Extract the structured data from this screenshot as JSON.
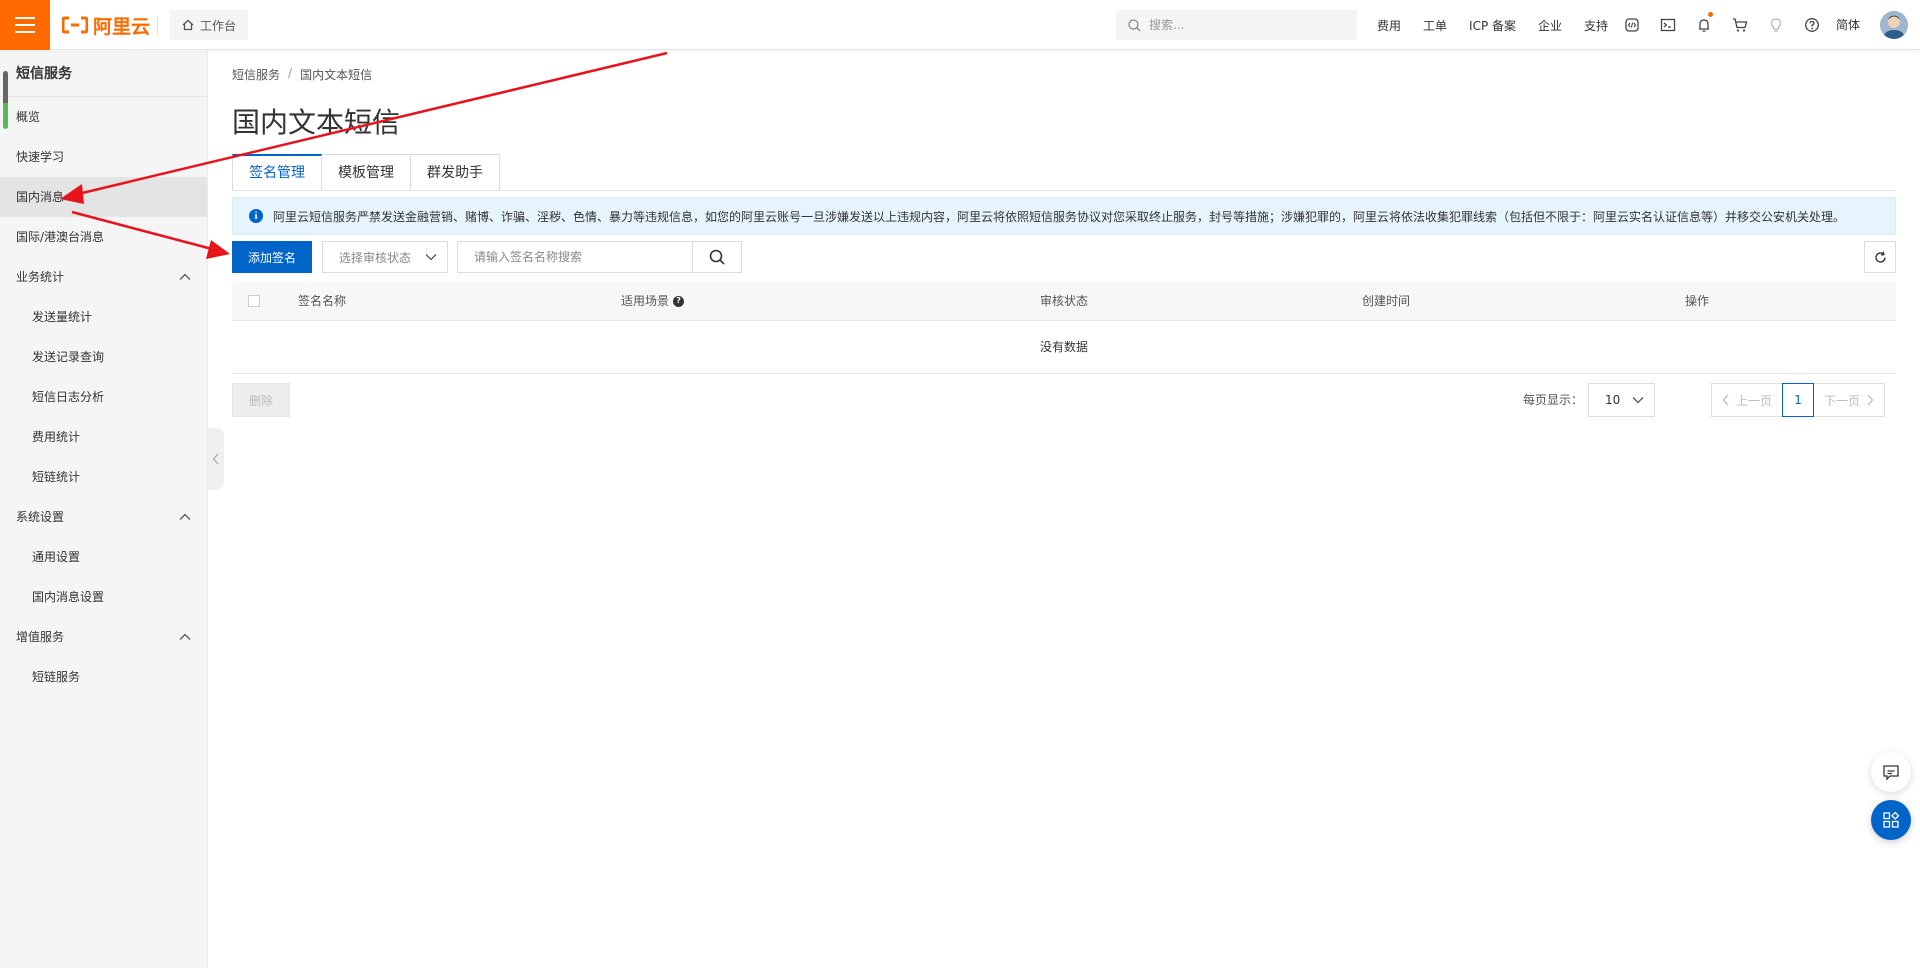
{
  "topbar": {
    "logo_text": "阿里云",
    "workbench_label": "工作台",
    "search_placeholder": "搜索...",
    "links": [
      "费用",
      "工单",
      "ICP 备案",
      "企业",
      "支持"
    ],
    "lang": "简体",
    "icons": [
      "code-icon",
      "terminal-icon",
      "bell-icon",
      "cart-icon",
      "bulb-icon",
      "help-icon"
    ]
  },
  "sidebar": {
    "title": "短信服务",
    "items": [
      {
        "label": "概览"
      },
      {
        "label": "快速学习"
      },
      {
        "label": "国内消息"
      },
      {
        "label": "国际/港澳台消息"
      },
      {
        "label": "业务统计"
      },
      {
        "label": "发送量统计"
      },
      {
        "label": "发送记录查询"
      },
      {
        "label": "短信日志分析"
      },
      {
        "label": "费用统计"
      },
      {
        "label": "短链统计"
      },
      {
        "label": "系统设置"
      },
      {
        "label": "通用设置"
      },
      {
        "label": "国内消息设置"
      },
      {
        "label": "增值服务"
      },
      {
        "label": "短链服务"
      }
    ]
  },
  "breadcrumb": [
    "短信服务",
    "国内文本短信"
  ],
  "breadcrumb_sep": "/",
  "page_title": "国内文本短信",
  "tabs": [
    "签名管理",
    "模板管理",
    "群发助手"
  ],
  "notice": "阿里云短信服务严禁发送金融营销、赌博、诈骗、淫秽、色情、暴力等违规信息，如您的阿里云账号一旦涉嫌发送以上违规内容，阿里云将依照短信服务协议对您采取终止服务，封号等措施；涉嫌犯罪的，阿里云将依法收集犯罪线索（包括但不限于：阿里云实名认证信息等）并移交公安机关处理。",
  "notice_icon": "i",
  "toolbar": {
    "add_button": "添加签名",
    "status_select": "选择审核状态",
    "search_placeholder": "请输入签名名称搜索"
  },
  "table": {
    "columns": [
      "签名名称",
      "适用场景",
      "审核状态",
      "创建时间",
      "操作"
    ],
    "help_glyph": "?",
    "empty_text": "没有数据"
  },
  "footer": {
    "delete_button": "删除",
    "page_size_label": "每页显示：",
    "page_size": "10",
    "prev": "上一页",
    "current_page": "1",
    "next": "下一页"
  },
  "colors": {
    "brand_orange": "#ff6a00",
    "primary_blue": "#0064c8",
    "annotation_red": "#e8141b"
  }
}
